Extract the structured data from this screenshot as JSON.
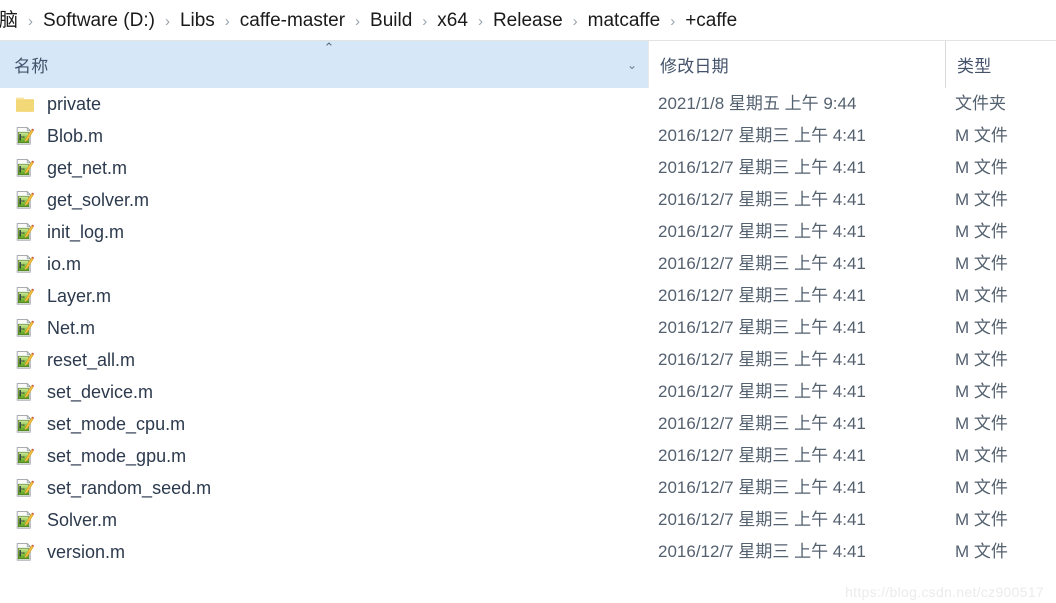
{
  "breadcrumb": {
    "separator": "›",
    "items": [
      {
        "label": "脑"
      },
      {
        "label": "Software (D:)"
      },
      {
        "label": "Libs"
      },
      {
        "label": "caffe-master"
      },
      {
        "label": "Build"
      },
      {
        "label": "x64"
      },
      {
        "label": "Release"
      },
      {
        "label": "matcaffe"
      },
      {
        "label": "+caffe"
      }
    ]
  },
  "columns": {
    "name": {
      "label": "名称",
      "sort": "ascending",
      "sort_glyph": "⌃",
      "chevron_glyph": "⌄"
    },
    "date": {
      "label": "修改日期"
    },
    "type": {
      "label": "类型"
    }
  },
  "colors": {
    "header_highlight": "#d6e7f8",
    "folder_icon": "#f5d97b",
    "matlab_icon_green": "#5cb531",
    "pencil": "#f0b429",
    "text": "#2c3a4d"
  },
  "files": [
    {
      "name": "private",
      "icon": "folder-icon",
      "date": "2021/1/8 星期五 上午 9:44",
      "type": "文件夹"
    },
    {
      "name": "Blob.m",
      "icon": "matlab-file-icon",
      "date": "2016/12/7 星期三 上午 4:41",
      "type": "M 文件"
    },
    {
      "name": "get_net.m",
      "icon": "matlab-file-icon",
      "date": "2016/12/7 星期三 上午 4:41",
      "type": "M 文件"
    },
    {
      "name": "get_solver.m",
      "icon": "matlab-file-icon",
      "date": "2016/12/7 星期三 上午 4:41",
      "type": "M 文件"
    },
    {
      "name": "init_log.m",
      "icon": "matlab-file-icon",
      "date": "2016/12/7 星期三 上午 4:41",
      "type": "M 文件"
    },
    {
      "name": "io.m",
      "icon": "matlab-file-icon",
      "date": "2016/12/7 星期三 上午 4:41",
      "type": "M 文件"
    },
    {
      "name": "Layer.m",
      "icon": "matlab-file-icon",
      "date": "2016/12/7 星期三 上午 4:41",
      "type": "M 文件"
    },
    {
      "name": "Net.m",
      "icon": "matlab-file-icon",
      "date": "2016/12/7 星期三 上午 4:41",
      "type": "M 文件"
    },
    {
      "name": "reset_all.m",
      "icon": "matlab-file-icon",
      "date": "2016/12/7 星期三 上午 4:41",
      "type": "M 文件"
    },
    {
      "name": "set_device.m",
      "icon": "matlab-file-icon",
      "date": "2016/12/7 星期三 上午 4:41",
      "type": "M 文件"
    },
    {
      "name": "set_mode_cpu.m",
      "icon": "matlab-file-icon",
      "date": "2016/12/7 星期三 上午 4:41",
      "type": "M 文件"
    },
    {
      "name": "set_mode_gpu.m",
      "icon": "matlab-file-icon",
      "date": "2016/12/7 星期三 上午 4:41",
      "type": "M 文件"
    },
    {
      "name": "set_random_seed.m",
      "icon": "matlab-file-icon",
      "date": "2016/12/7 星期三 上午 4:41",
      "type": "M 文件"
    },
    {
      "name": "Solver.m",
      "icon": "matlab-file-icon",
      "date": "2016/12/7 星期三 上午 4:41",
      "type": "M 文件"
    },
    {
      "name": "version.m",
      "icon": "matlab-file-icon",
      "date": "2016/12/7 星期三 上午 4:41",
      "type": "M 文件"
    }
  ],
  "watermark": {
    "text": "https://blog.csdn.net/cz900517"
  }
}
